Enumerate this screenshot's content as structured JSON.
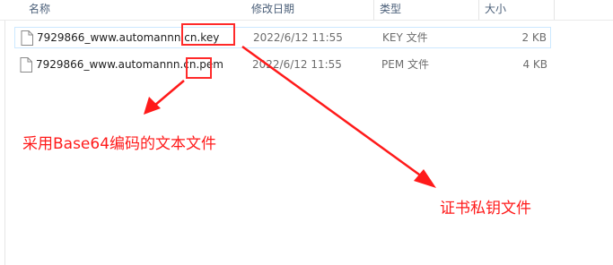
{
  "columns": {
    "name": "名称",
    "date": "修改日期",
    "type": "类型",
    "size": "大小"
  },
  "files": [
    {
      "name": "7929866_www.automannn.cn.key",
      "date": "2022/6/12 11:55",
      "type": "KEY 文件",
      "size": "2 KB",
      "icon": "document-icon",
      "selected": true
    },
    {
      "name": "7929866_www.automannn.cn.pem",
      "date": "2022/6/12 11:55",
      "type": "PEM 文件",
      "size": "4 KB",
      "icon": "document-icon",
      "selected": false
    }
  ],
  "annotations": {
    "pem_label": "采用Base64编码的文本文件",
    "key_label": "证书私钥文件"
  },
  "colors": {
    "annotation": "#ff1a1a",
    "header_text": "#4c607a",
    "selection_border": "#cce8ff"
  }
}
